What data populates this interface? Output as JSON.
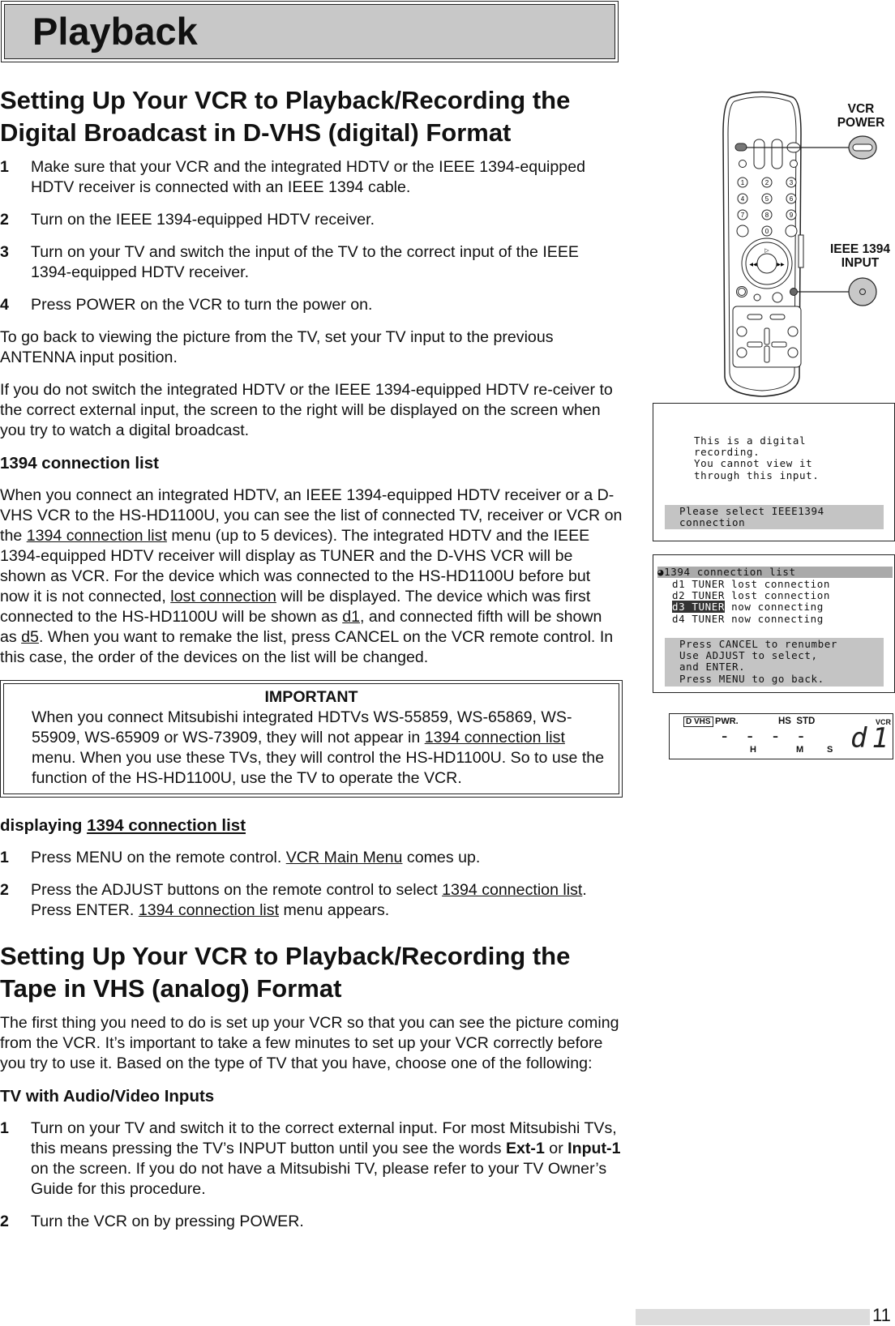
{
  "header": {
    "title": "Playback"
  },
  "section1": {
    "title": "Setting Up Your VCR to Playback/Recording the Digital Broadcast in D-VHS (digital) Format",
    "steps": [
      {
        "num": "1",
        "text": "Make sure that your VCR and the integrated HDTV or the IEEE 1394-equipped HDTV receiver is connected with an IEEE 1394 cable."
      },
      {
        "num": "2",
        "text": "Turn on the IEEE 1394-equipped HDTV receiver."
      },
      {
        "num": "3",
        "text": "Turn on your TV and switch the input of the TV to the correct input of the IEEE 1394-equipped HDTV receiver."
      },
      {
        "num": "4",
        "text": "Press POWER on the VCR to turn the power on."
      }
    ],
    "para1": "To go back to viewing the picture from the TV, set your TV input to the previous ANTENNA input position.",
    "para2": "If you do not switch the integrated HDTV or the IEEE 1394-equipped HDTV re-ceiver to the correct external input, the screen to the right will be displayed on the screen when you try to watch a digital broadcast."
  },
  "connlist": {
    "title": "1394 connection list",
    "para": [
      {
        "t": "When you connect an integrated HDTV, an IEEE 1394-equipped HDTV receiver or a D-VHS VCR to the HS-HD1100U, you can see the list of connected TV, receiver or VCR on the "
      },
      {
        "t": "1394 connection list",
        "s": "u"
      },
      {
        "t": " menu (up to 5 devices).  The integrated HDTV and the IEEE 1394-equipped HDTV receiver will display as TUNER and the D-VHS VCR will be shown as VCR.  For the device which was connected to the HS-HD1100U before but now it is not connected, "
      },
      {
        "t": "lost connection",
        "s": "u"
      },
      {
        "t": " will be displayed.  The device which was first connected to the HS-HD1100U will be shown as "
      },
      {
        "t": "d1",
        "s": "u"
      },
      {
        "t": ", and connected fifth will be shown as "
      },
      {
        "t": "d5",
        "s": "u"
      },
      {
        "t": ".  When you want to remake the list, press CANCEL on the VCR remote control.  In this case, the order of the devices on the list will be changed."
      }
    ]
  },
  "important": {
    "title": "IMPORTANT",
    "para": [
      {
        "t": "When you connect Mitsubishi integrated HDTVs WS-55859, WS-65869, WS-55909, WS-65909 or WS-73909, they will not appear in "
      },
      {
        "t": "1394 connection list",
        "s": "u"
      },
      {
        "t": " menu.   When you use these TVs, they will control the HS-HD1100U.  So to use the function of the HS-HD1100U, use the TV to operate the VCR."
      }
    ]
  },
  "displaying": {
    "title": [
      {
        "t": "displaying "
      },
      {
        "t": "1394 connection list",
        "s": "u"
      }
    ],
    "steps": [
      {
        "num": "1",
        "para": [
          {
            "t": "Press MENU on the remote control.  "
          },
          {
            "t": "VCR Main Menu",
            "s": "u"
          },
          {
            "t": " comes up."
          }
        ]
      },
      {
        "num": "2",
        "para": [
          {
            "t": "Press the ADJUST buttons on the remote control to select "
          },
          {
            "t": "1394 connection list",
            "s": "u"
          },
          {
            "t": ".  Press ENTER.  "
          },
          {
            "t": "1394 connection list",
            "s": "u"
          },
          {
            "t": " menu appears."
          }
        ]
      }
    ]
  },
  "section2": {
    "title": "Setting Up Your VCR to Playback/Recording the Tape in VHS (analog) Format",
    "para": "The first thing you need to do is set up your VCR so that you can see the picture coming from the VCR.  It’s important to take a few minutes to set up your VCR correctly before you try to use it.  Based on the type of TV that you have, choose one of the following:",
    "subtitle": "TV with Audio/Video Inputs",
    "steps": [
      {
        "num": "1",
        "para": [
          {
            "t": "Turn on your TV and switch it to the correct external input.  For most Mitsubishi TVs, this means pressing the TV’s INPUT button until you see the words "
          },
          {
            "t": "Ext-1",
            "s": "b"
          },
          {
            "t": " or "
          },
          {
            "t": "Input-1",
            "s": "b"
          },
          {
            "t": " on the screen.  If you do not have a Mitsubishi TV, please refer to your TV Owner’s Guide for this procedure."
          }
        ]
      },
      {
        "num": "2",
        "para": [
          {
            "t": "Turn the VCR on by pressing POWER."
          }
        ]
      }
    ]
  },
  "remote": {
    "vcr_power_label": [
      "VCR",
      "POWER"
    ],
    "ieee_label": [
      "IEEE 1394",
      "INPUT"
    ],
    "digits": [
      "1",
      "2",
      "3",
      "4",
      "5",
      "6",
      "7",
      "8",
      "9",
      "0"
    ]
  },
  "screen1": {
    "lines": [
      "This is a digital",
      "recording.",
      "You cannot view it",
      "through this input."
    ],
    "bar": [
      "Please select IEEE1394",
      "connection"
    ]
  },
  "screen2": {
    "title": "1394 connection list",
    "rows": [
      {
        "id": "d1 TUNER",
        "status": "lost connection"
      },
      {
        "id": "d2 TUNER",
        "status": "lost connection"
      },
      {
        "id": "d3 TUNER",
        "status": "now connecting",
        "selected": true
      },
      {
        "id": "d4 TUNER",
        "status": "now connecting"
      }
    ],
    "help": [
      "Press CANCEL to renumber",
      "Use ADJUST to select,",
      "and ENTER.",
      "Press MENU to go back."
    ]
  },
  "lcd": {
    "logo": "D VHS",
    "pwr": "PWR.",
    "mode": "HS  STD",
    "vcr": "VCR",
    "h": "H",
    "m": "M",
    "s": "S",
    "digits": "d1"
  },
  "page_number": "11"
}
